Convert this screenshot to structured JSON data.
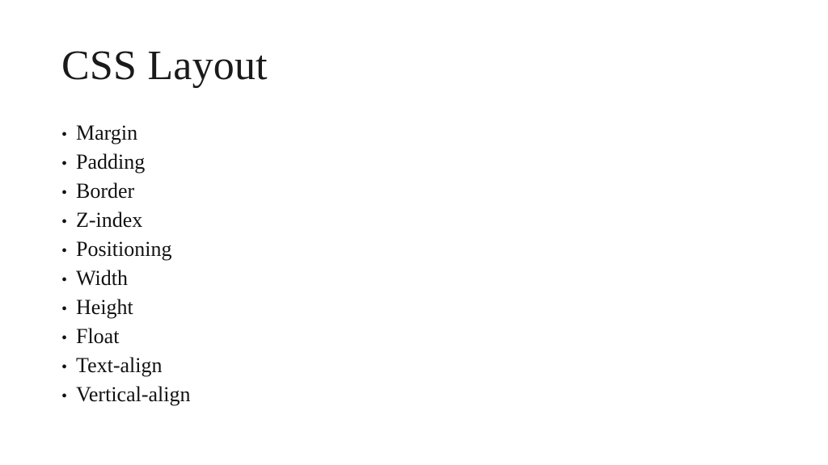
{
  "slide": {
    "title": "CSS Layout",
    "background_color": "#ffffff",
    "text_color": "#111111",
    "bullet_marker": "•",
    "bullets": [
      {
        "label": "Margin"
      },
      {
        "label": "Padding"
      },
      {
        "label": "Border"
      },
      {
        "label": "Z-index"
      },
      {
        "label": "Positioning"
      },
      {
        "label": "Width"
      },
      {
        "label": "Height"
      },
      {
        "label": "Float"
      },
      {
        "label": "Text-align"
      },
      {
        "label": "Vertical-align"
      }
    ]
  }
}
